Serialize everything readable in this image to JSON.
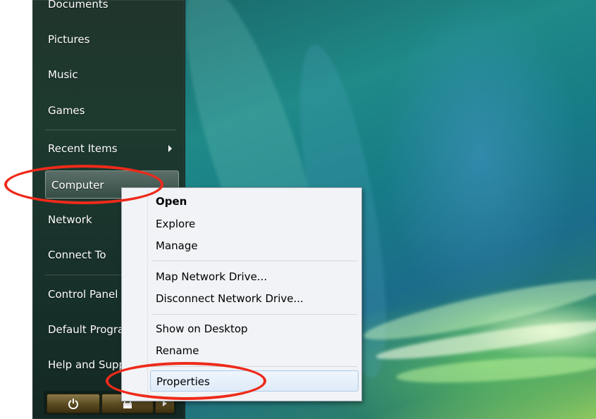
{
  "start_menu": {
    "items": [
      {
        "label": "Documents"
      },
      {
        "label": "Pictures"
      },
      {
        "label": "Music"
      },
      {
        "label": "Games"
      },
      {
        "label": "Recent Items",
        "has_submenu": true
      },
      {
        "label": "Computer",
        "highlighted": true
      },
      {
        "label": "Network"
      },
      {
        "label": "Connect To"
      },
      {
        "label": "Control Panel"
      },
      {
        "label": "Default Programs"
      },
      {
        "label": "Help and Support"
      }
    ],
    "power_icon": "power-icon",
    "lock_icon": "lock-icon",
    "arrow_icon": "chevron-right-icon"
  },
  "context_menu": {
    "items": [
      {
        "label": "Open",
        "bold": true
      },
      {
        "label": "Explore"
      },
      {
        "label": "Manage"
      },
      {
        "label": "Map Network Drive..."
      },
      {
        "label": "Disconnect Network Drive..."
      },
      {
        "label": "Show on Desktop"
      },
      {
        "label": "Rename"
      },
      {
        "label": "Properties",
        "highlighted": true
      }
    ]
  },
  "annotations": {
    "color": "#ee2a1a"
  }
}
